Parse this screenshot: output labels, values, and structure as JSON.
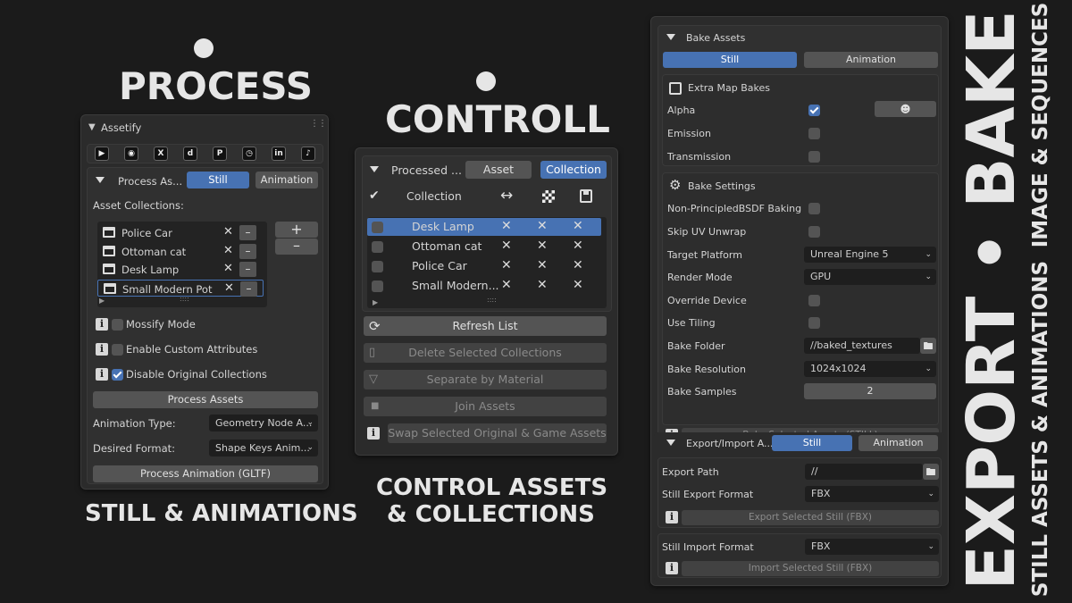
{
  "headlines": {
    "process": "PROCESS",
    "controll": "CONTROLL",
    "still_anim": "STILL & ANIMATIONS",
    "control_assets_1": "CONTROL ASSETS",
    "control_assets_2": "& COLLECTIONS",
    "export_bake": "EXPORT • BAKE",
    "image_seq": "IMAGE & SEQUENCES",
    "still_assets_anim": "STILL ASSETS & ANIMATIONS"
  },
  "assetify": {
    "title": "Assetify",
    "social_icons": [
      "youtube-icon",
      "instagram-icon",
      "x-icon",
      "discord-icon",
      "patreon-icon",
      "clock-icon",
      "linkedin-icon",
      "tiktok-icon"
    ],
    "process_label": "Process As...",
    "tab_still": "Still",
    "tab_animation": "Animation",
    "collections_label": "Asset Collections:",
    "collections": [
      "Police Car",
      "Ottoman cat",
      "Desk Lamp",
      "Small Modern Pot"
    ],
    "mossify": "Mossify Mode",
    "custom_attrs": "Enable Custom Attributes",
    "disable_orig": "Disable Original Collections",
    "process_assets": "Process Assets",
    "anim_type_label": "Animation Type:",
    "anim_type_value": "Geometry Node A...",
    "format_label": "Desired Format:",
    "format_value": "Shape Keys Anim...",
    "process_anim": "Process Animation (GLTF)"
  },
  "controll": {
    "processed_label": "Processed ...",
    "tab_asset": "Asset",
    "tab_collection": "Collection",
    "collection_label": "Collection",
    "rows": [
      "Desk Lamp",
      "Ottoman cat",
      "Police Car",
      "Small Modern..."
    ],
    "refresh": "Refresh List",
    "delete": "Delete Selected Collections",
    "separate": "Separate by Material",
    "join": "Join Assets",
    "swap": "Swap Selected Original & Game Assets"
  },
  "bake": {
    "title": "Bake Assets",
    "tab_still": "Still",
    "tab_animation": "Animation",
    "extra_title": "Extra Map Bakes",
    "alpha": "Alpha",
    "emission": "Emission",
    "transmission": "Transmission",
    "settings_title": "Bake Settings",
    "non_principled": "Non-PrincipledBSDF Baking",
    "skip_uv": "Skip UV Unwrap",
    "target_label": "Target Platform",
    "target_value": "Unreal Engine 5",
    "render_label": "Render Mode",
    "render_value": "GPU",
    "override_label": "Override Device",
    "tiling_label": "Use Tiling",
    "folder_label": "Bake Folder",
    "folder_value": "//baked_textures",
    "res_label": "Bake Resolution",
    "res_value": "1024x1024",
    "samples_label": "Bake Samples",
    "samples_value": "2",
    "bake_selected": "Bake Selected Assets (STILL)",
    "export_title": "Export/Import A...",
    "export_still": "Still",
    "export_anim": "Animation",
    "export_path_label": "Export Path",
    "export_path_value": "//",
    "export_format_label": "Still Export Format",
    "export_format_value": "FBX",
    "export_selected": "Export Selected Still (FBX)",
    "import_format_label": "Still Import Format",
    "import_format_value": "FBX",
    "import_selected": "Import Selected Still (FBX)"
  }
}
